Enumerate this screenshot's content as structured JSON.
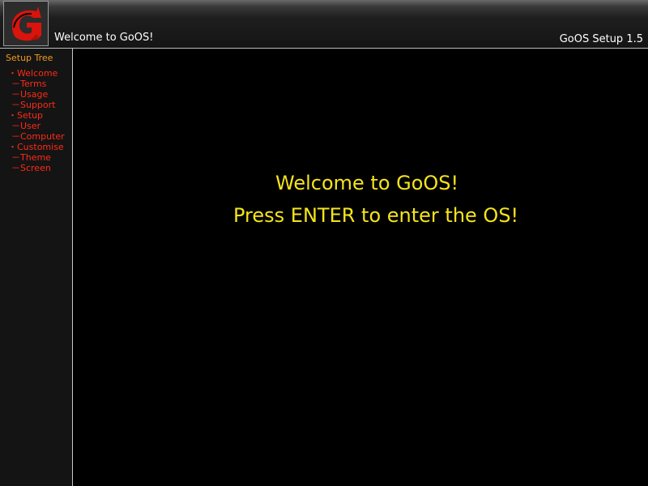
{
  "header": {
    "logo_letter": "G",
    "window_title": "Welcome to GoOS!",
    "app_version": "GoOS Setup 1.5"
  },
  "sidebar": {
    "title": "Setup Tree",
    "items": [
      {
        "label": "・Welcome",
        "level": "section"
      },
      {
        "label": "－Terms",
        "level": "sub"
      },
      {
        "label": "－Usage",
        "level": "sub"
      },
      {
        "label": "－Support",
        "level": "sub"
      },
      {
        "label": "・Setup",
        "level": "section"
      },
      {
        "label": "－User",
        "level": "sub"
      },
      {
        "label": "－Computer",
        "level": "sub"
      },
      {
        "label": "・Customise",
        "level": "section"
      },
      {
        "label": "－Theme",
        "level": "sub"
      },
      {
        "label": "－Screen",
        "level": "sub"
      }
    ]
  },
  "main": {
    "welcome_message": "Welcome to GoOS!",
    "instruction": "Press ENTER to enter the OS!"
  },
  "colors": {
    "tree_title": "#f29a1d",
    "tree_item": "#ff2a18",
    "message": "#f5e41b",
    "logo_red": "#d8140c"
  }
}
